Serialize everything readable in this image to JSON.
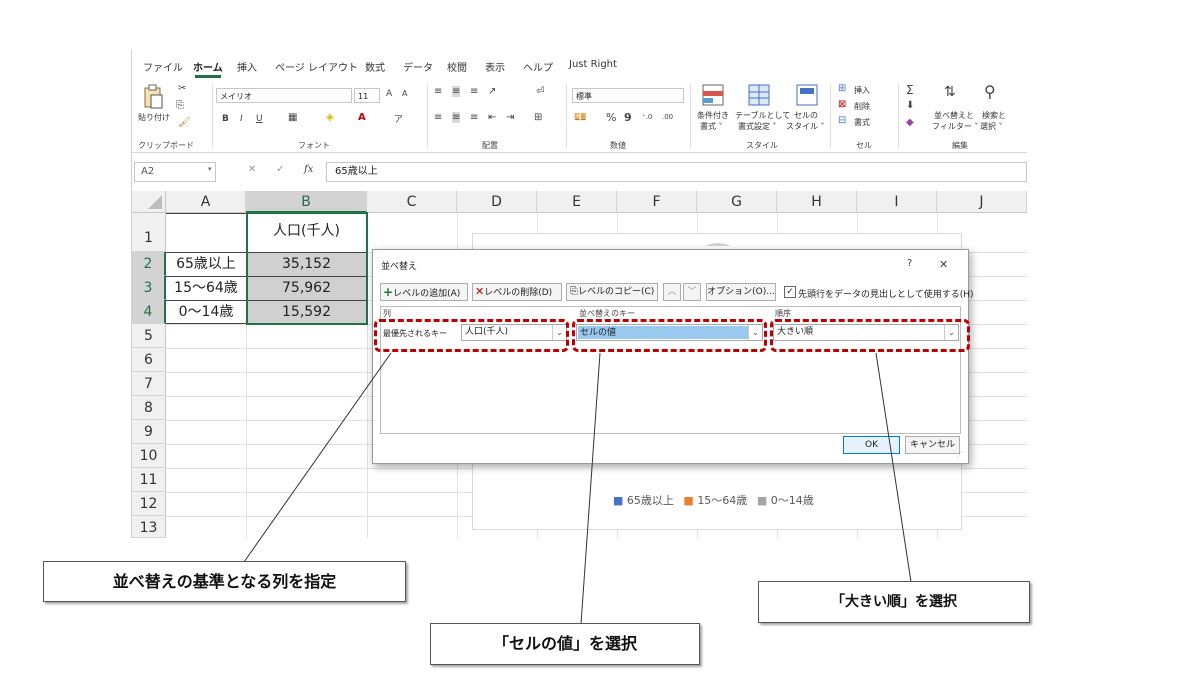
{
  "menu": {
    "tabs": [
      "ファイル",
      "ホーム",
      "挿入",
      "ページ レイアウト",
      "数式",
      "データ",
      "校閲",
      "表示",
      "ヘルプ",
      "Just Right"
    ],
    "active": "ホーム"
  },
  "ribbon": {
    "clipboard": {
      "paste": "貼り付け",
      "label": "クリップボード"
    },
    "font": {
      "name": "メイリオ",
      "size": "11",
      "grow": "A^",
      "shrink": "A˅",
      "bold": "B",
      "italic": "I",
      "underline": "U",
      "label": "フォント"
    },
    "alignment": {
      "label": "配置"
    },
    "number": {
      "format": "標準",
      "percent": "%",
      "comma": "9",
      "label": "数値"
    },
    "styles": {
      "conditional": "条件付き",
      "conditional2": "書式 ˅",
      "table": "テーブルとして",
      "table2": "書式設定 ˅",
      "cell": "セルの",
      "cell2": "スタイル ˅",
      "label": "スタイル"
    },
    "cells": {
      "insert": "挿入",
      "delete": "削除",
      "format": "書式",
      "label": "セル"
    },
    "editing": {
      "sum": "Σ",
      "sort": "並べ替えと",
      "sort2": "フィルター ˅",
      "find": "検索と",
      "find2": "選択 ˅",
      "label": "編集"
    }
  },
  "formula_bar": {
    "name_box": "A2",
    "fx": "fx",
    "value": "65歳以上"
  },
  "sheet": {
    "columns": [
      "A",
      "B",
      "C",
      "D",
      "E",
      "F",
      "G",
      "H",
      "I",
      "J"
    ],
    "rows": [
      "1",
      "2",
      "3",
      "4",
      "5",
      "6",
      "7",
      "8",
      "9",
      "10",
      "11",
      "12",
      "13"
    ],
    "header_b": "人口(千人)",
    "data": [
      {
        "label": "65歳以上",
        "value": "35,152"
      },
      {
        "label": "15〜64歳",
        "value": "75,962"
      },
      {
        "label": "0〜14歳",
        "value": "15,592"
      }
    ]
  },
  "chart": {
    "legend": [
      {
        "name": "65歳以上",
        "color": "#4472c4"
      },
      {
        "name": "15〜64歳",
        "color": "#ed7d31"
      },
      {
        "name": "0〜14歳",
        "color": "#a5a5a5"
      }
    ]
  },
  "dialog": {
    "title": "並べ替え",
    "help": "?",
    "close": "✕",
    "add_level": "レベルの追加(A)",
    "delete_level": "レベルの削除(D)",
    "copy_level": "レベルのコピー(C)",
    "options": "オプション(O)...",
    "header_checkbox": "先頭行をデータの見出しとして使用する(H)",
    "col_header": "列",
    "sorton_header": "並べ替えのキー",
    "order_header": "順序",
    "priority_key": "最優先されるキー",
    "column_value": "人口(千人)",
    "sorton_value": "セルの値",
    "order_value": "大きい順",
    "ok": "OK",
    "cancel": "キャンセル"
  },
  "callouts": {
    "column": "並べ替えの基準となる列を指定",
    "sorton": "「セルの値」を選択",
    "order": "「大きい順」を選択"
  },
  "colors": {
    "excel_green": "#217346",
    "highlight": "#c00000",
    "selection": "#99c9ef"
  }
}
